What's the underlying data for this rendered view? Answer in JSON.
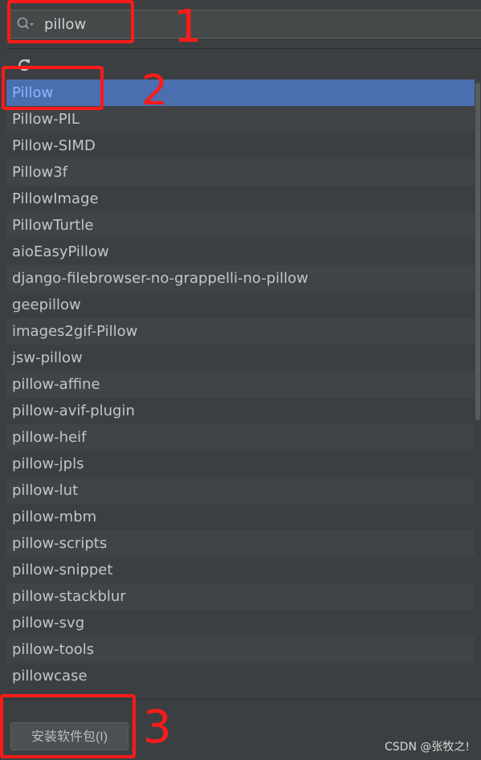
{
  "search": {
    "value": "pillow"
  },
  "packages": [
    "Pillow",
    "Pillow-PIL",
    "Pillow-SIMD",
    "Pillow3f",
    "PillowImage",
    "PillowTurtle",
    "aioEasyPillow",
    "django-filebrowser-no-grappelli-no-pillow",
    "geepillow",
    "images2gif-Pillow",
    "jsw-pillow",
    "pillow-affine",
    "pillow-avif-plugin",
    "pillow-heif",
    "pillow-jpls",
    "pillow-lut",
    "pillow-mbm",
    "pillow-scripts",
    "pillow-snippet",
    "pillow-stackblur",
    "pillow-svg",
    "pillow-tools",
    "pillowcase"
  ],
  "selected_index": 0,
  "install_button": {
    "label": "安装软件包(I)"
  },
  "watermark": "CSDN @张牧之!",
  "annotations": [
    {
      "label": "1"
    },
    {
      "label": "2"
    },
    {
      "label": "3"
    }
  ],
  "colors": {
    "selection": "#4b6eaf",
    "annotation": "#ff1a1a"
  },
  "icons": {
    "search": "search-icon",
    "refresh": "refresh-icon"
  }
}
